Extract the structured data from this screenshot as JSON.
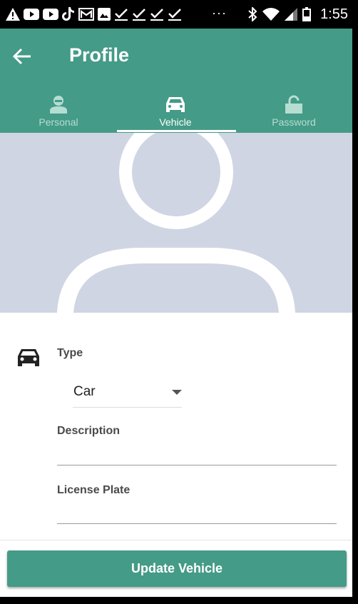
{
  "status_bar": {
    "left_icons": [
      "warning-icon",
      "youtube-icon",
      "youtube-icon",
      "tiktok-icon",
      "gmail-icon",
      "image-icon",
      "check-icon",
      "check-icon",
      "check-icon",
      "check-icon"
    ],
    "more": "···",
    "right_icons": [
      "bluetooth-icon",
      "wifi-icon",
      "signal-icon",
      "battery-icon"
    ],
    "time": "1:55"
  },
  "app_bar": {
    "title": "Profile",
    "back_icon": "arrow-left-icon",
    "color": "#449b87"
  },
  "tabs": [
    {
      "label": "Personal",
      "icon": "person-icon",
      "active": false
    },
    {
      "label": "Vehicle",
      "icon": "car-icon",
      "active": true
    },
    {
      "label": "Password",
      "icon": "lock-open-icon",
      "active": false
    }
  ],
  "form": {
    "type_icon": "car-icon",
    "type_label": "Type",
    "type_value": "Car",
    "description_label": "Description",
    "description_value": "",
    "license_label": "License Plate",
    "license_value": ""
  },
  "update_button": "Update Vehicle"
}
